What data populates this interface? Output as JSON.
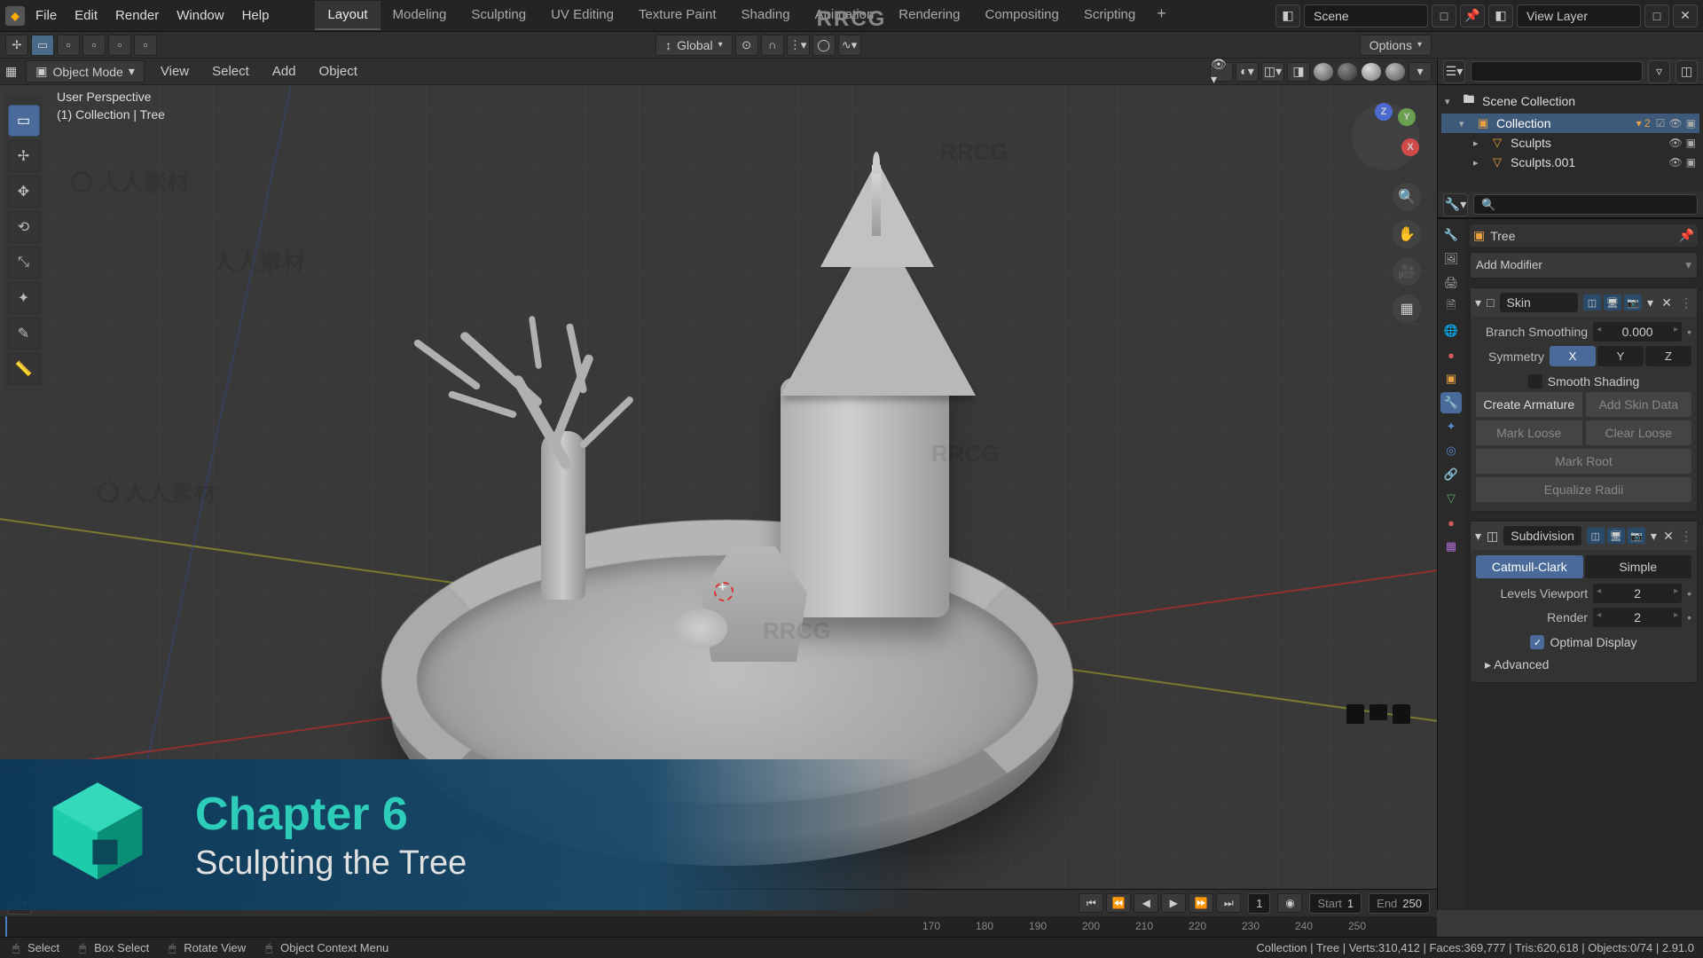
{
  "watermark": {
    "top": "RRCG",
    "body": "人人素材",
    "body2": "RRCG"
  },
  "menu": {
    "items": [
      "File",
      "Edit",
      "Render",
      "Window",
      "Help"
    ],
    "workspaces": [
      "Layout",
      "Modeling",
      "Sculpting",
      "UV Editing",
      "Texture Paint",
      "Shading",
      "Animation",
      "Rendering",
      "Compositing",
      "Scripting"
    ],
    "active_ws": "Layout",
    "scene": "Scene",
    "view_layer": "View Layer"
  },
  "toolbar": {
    "orientation": "Global",
    "options": "Options"
  },
  "viewport_header": {
    "mode": "Object Mode",
    "menus": [
      "View",
      "Select",
      "Add",
      "Object"
    ]
  },
  "viewport": {
    "persp_line1": "User Perspective",
    "persp_line2": "(1) Collection | Tree",
    "gizmo": {
      "x": "X",
      "y": "Y",
      "z": "Z"
    }
  },
  "outliner": {
    "title": "Scene Collection",
    "collection": "Collection",
    "coll_badge": "▾ 2",
    "items": [
      "Sculpts",
      "Sculpts.001"
    ]
  },
  "properties": {
    "breadcrumb": "Tree",
    "add_modifier": "Add Modifier",
    "skin": {
      "name": "Skin",
      "branch_smoothing_label": "Branch Smoothing",
      "branch_smoothing_value": "0.000",
      "symmetry_label": "Symmetry",
      "sym_x": "X",
      "sym_y": "Y",
      "sym_z": "Z",
      "smooth_shading": "Smooth Shading",
      "create_armature": "Create Armature",
      "add_skin_data": "Add Skin Data",
      "mark_loose": "Mark Loose",
      "clear_loose": "Clear Loose",
      "mark_root": "Mark Root",
      "equalize_radii": "Equalize Radii"
    },
    "subdiv": {
      "name": "Subdivision",
      "catmull": "Catmull-Clark",
      "simple": "Simple",
      "levels_vp_label": "Levels Viewport",
      "levels_vp_value": "2",
      "render_label": "Render",
      "render_value": "2",
      "optimal_display": "Optimal Display",
      "advanced": "Advanced"
    }
  },
  "timeline": {
    "current": "1",
    "start_label": "Start",
    "start": "1",
    "end_label": "End",
    "end": "250",
    "ticks": [
      "170",
      "180",
      "190",
      "200",
      "210",
      "220",
      "230",
      "240",
      "250"
    ]
  },
  "status": {
    "left": [
      {
        "icon": "🖱",
        "text": "Select"
      },
      {
        "icon": "🖱",
        "text": "Box Select"
      },
      {
        "icon": "🖱",
        "text": "Rotate View"
      },
      {
        "icon": "🖱",
        "text": "Object Context Menu"
      }
    ],
    "right": "Collection | Tree | Verts:310,412 | Faces:369,777 | Tris:620,618 | Objects:0/74 | 2.91.0"
  },
  "chapter": {
    "line1": "Chapter 6",
    "line2": "Sculpting the Tree"
  }
}
